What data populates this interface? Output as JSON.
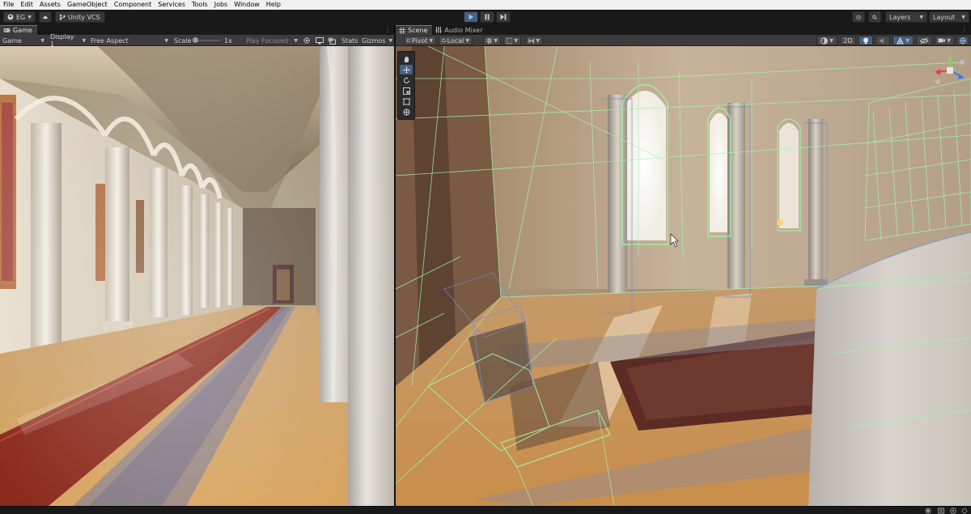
{
  "menubar": {
    "items": [
      "File",
      "Edit",
      "Assets",
      "GameObject",
      "Component",
      "Services",
      "Tools",
      "Jobs",
      "Window",
      "Help"
    ]
  },
  "toolbar": {
    "account_label": "EG",
    "vcs_label": "Unity VCS",
    "layers_label": "Layers",
    "layout_label": "Layout",
    "play_state": "playing"
  },
  "game_panel": {
    "tab_label": "Game",
    "view_mode": "Game",
    "display": "Display 1",
    "aspect": "Free Aspect",
    "scale_label": "Scale",
    "scale_value": "1x",
    "play_focused": "Play Focused",
    "stats_label": "Stats",
    "gizmos_label": "Gizmos"
  },
  "scene_panel": {
    "tabs": [
      {
        "label": "Scene",
        "icon": "grid-icon",
        "active": true
      },
      {
        "label": "Audio Mixer",
        "icon": "mixer-icon",
        "active": false
      }
    ],
    "pivot_label": "Pivot",
    "space_label": "Local",
    "mode_2d_label": "2D"
  },
  "colors": {
    "accent": "#4a78c8",
    "play_active": "#46607f",
    "wireframe": "#8ff0a0"
  }
}
